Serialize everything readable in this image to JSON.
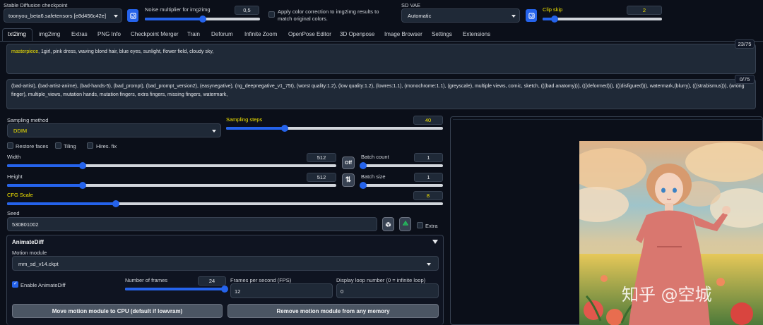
{
  "top": {
    "checkpoint_label": "Stable Diffusion checkpoint",
    "checkpoint_value": "toonyou_beta6.safetensors [e8d456c42e]",
    "noise_label": "Noise multiplier for img2img",
    "noise_value": "0,5",
    "noise_fraction": 0.5,
    "color_correction_label": "Apply color correction to img2img results to match original colors.",
    "vae_label": "SD VAE",
    "vae_value": "Automatic",
    "clip_label": "Clip skip",
    "clip_value": "2",
    "clip_fraction": 0.1
  },
  "tabs": [
    "txt2img",
    "img2img",
    "Extras",
    "PNG Info",
    "Checkpoint Merger",
    "Train",
    "Deforum",
    "Infinite Zoom",
    "OpenPose Editor",
    "3D Openpose",
    "Image Browser",
    "Settings",
    "Extensions"
  ],
  "prompt": {
    "highlight": "masterpiece",
    "text": ", 1girl, pink dress, waving blond hair, blue eyes, sunlight, flower field, cloudy sky,",
    "token_count": "23/75"
  },
  "negative": {
    "text": "(bad-artist), (bad-artist-anime), (bad-hands-5), (bad_prompt), (bad_prompt_version2), (easynegative), (ng_deepnegative_v1_75t), (worst quality:1.2), (low quality:1.2), (lowres:1.1), (monochrome:1.1), (greyscale), multiple views, comic, sketch, (((bad anatomy))), (((deformed))), (((disfigured))), watermark,(blurry), (((strabismus))), (wrong finger), multiple_views, mutation hands, mutation fingers, extra fingers, missing fingers, watermark,",
    "token_count": "0/75"
  },
  "sampling": {
    "method_label": "Sampling method",
    "method_value": "DDIM",
    "steps_label": "Sampling steps",
    "steps_value": "40",
    "steps_fraction": 0.27
  },
  "checkboxes": {
    "restore_faces": "Restore faces",
    "tiling": "Tiling",
    "hires_fix": "Hires. fix"
  },
  "width": {
    "label": "Width",
    "value": "512",
    "fraction": 0.23
  },
  "height": {
    "label": "Height",
    "value": "512",
    "fraction": 0.23
  },
  "off_button": "Off",
  "swap_icon": "⇅",
  "batch_count": {
    "label": "Batch count",
    "value": "1",
    "fraction": 0.0
  },
  "batch_size": {
    "label": "Batch size",
    "value": "1",
    "fraction": 0.0
  },
  "cfg": {
    "label": "CFG Scale",
    "value": "8",
    "fraction": 0.25
  },
  "seed": {
    "label": "Seed",
    "value": "530801002",
    "extra_label": "Extra"
  },
  "animatediff": {
    "title": "AnimateDiff",
    "motion_label": "Motion module",
    "motion_value": "mm_sd_v14.ckpt",
    "enable_label": "Enable AnimateDiff",
    "frames_label": "Number of frames",
    "frames_value": "24",
    "frames_fraction": 1.0,
    "fps_label": "Frames per second (FPS)",
    "fps_value": "12",
    "loop_label": "Display loop number (0 = infinite loop)",
    "loop_value": "0",
    "move_button": "Move motion module to CPU (default if lowvram)",
    "remove_button": "Remove motion module from any memory"
  },
  "watermark": "知乎 @空城",
  "colors": {
    "accent": "#2563eb",
    "highlight": "#f4e500",
    "background": "#0b0f19"
  }
}
